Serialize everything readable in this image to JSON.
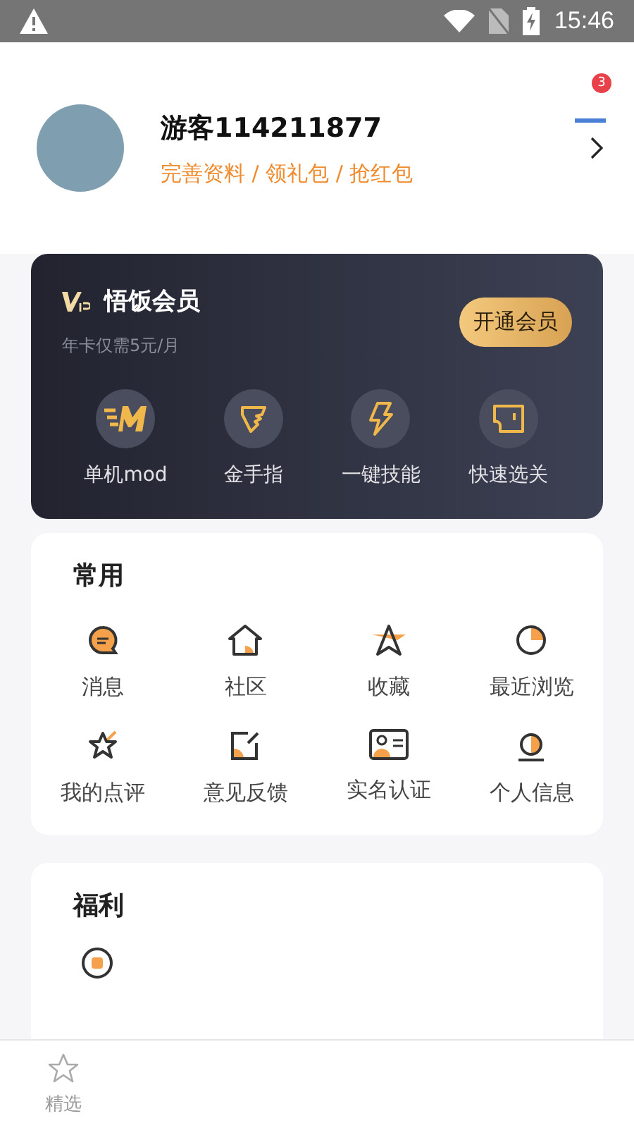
{
  "status_bar": {
    "time": "15:46"
  },
  "notifications": {
    "badge": "3"
  },
  "profile": {
    "name": "游客114211877",
    "subtitle": "完善资料 / 领礼包 / 抢红包"
  },
  "vip": {
    "title": "悟饭会员",
    "subtitle": "年卡仅需5元/月",
    "button": "开通会员",
    "features": [
      {
        "label": "单机mod",
        "kind": "mod"
      },
      {
        "label": "金手指",
        "kind": "wing"
      },
      {
        "label": "一键技能",
        "kind": "bolt"
      },
      {
        "label": "快速选关",
        "kind": "ticket"
      }
    ]
  },
  "common": {
    "title": "常用",
    "items": [
      {
        "label": "消息",
        "kind": "message"
      },
      {
        "label": "社区",
        "kind": "home"
      },
      {
        "label": "收藏",
        "kind": "star"
      },
      {
        "label": "最近浏览",
        "kind": "clock"
      },
      {
        "label": "我的点评",
        "kind": "review"
      },
      {
        "label": "意见反馈",
        "kind": "edit"
      },
      {
        "label": "实名认证",
        "kind": "idcard"
      },
      {
        "label": "个人信息",
        "kind": "person"
      }
    ]
  },
  "welfare": {
    "title": "福利"
  },
  "bottom_nav": [
    {
      "label": "精选",
      "selected": false
    }
  ]
}
